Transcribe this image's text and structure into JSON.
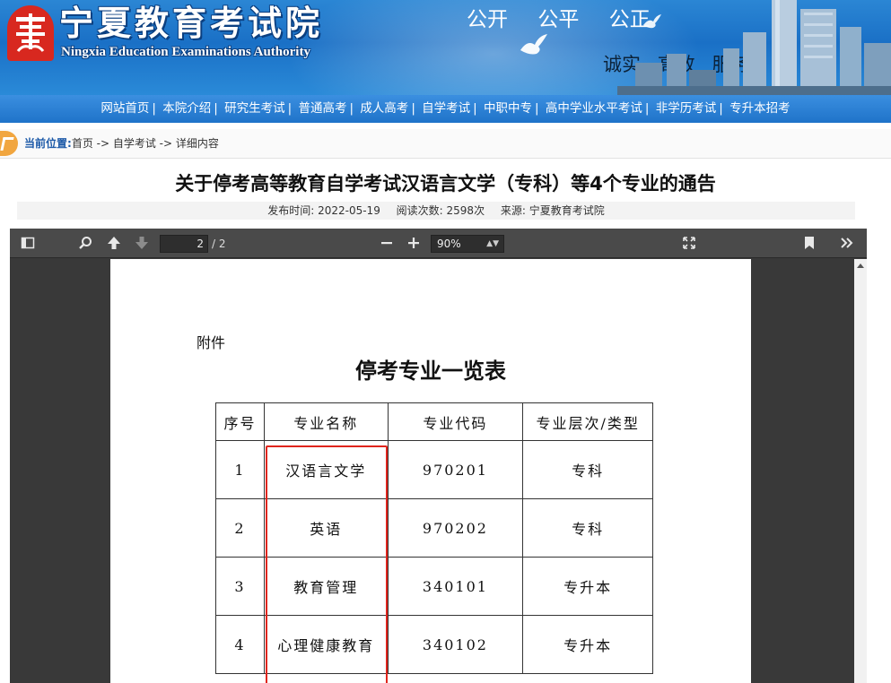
{
  "header": {
    "site_name_cn": "宁夏教育考试院",
    "site_name_en": "Ningxia Education Examinations Authority",
    "slogan_top": [
      "公开",
      "公平",
      "公正"
    ],
    "slogan_bottom": [
      "诚实",
      "高效",
      "服务"
    ]
  },
  "nav": {
    "items": [
      "网站首页",
      "本院介绍",
      "研究生考试",
      "普通高考",
      "成人高考",
      "自学考试",
      "中职中专",
      "高中学业水平考试",
      "非学历考试",
      "专升本招考"
    ]
  },
  "breadcrumb": {
    "label": "当前位置:",
    "path": "首页 -> 自学考试 -> 详细内容"
  },
  "article": {
    "title": "关于停考高等教育自学考试汉语言文学（专科）等4个专业的通告",
    "publish_time": "发布时间:   2022-05-19",
    "views": "阅读次数: 2598次",
    "source": "来源: 宁夏教育考试院"
  },
  "pdf_toolbar": {
    "page_number": "2",
    "page_count": "/ 2",
    "zoom": "90%"
  },
  "document": {
    "attachment_label": "附件",
    "title": "停考专业一览表",
    "table": {
      "headers": [
        "序号",
        "专业名称",
        "专业代码",
        "专业层次/类型"
      ],
      "rows": [
        [
          "1",
          "汉语言文学",
          "970201",
          "专科"
        ],
        [
          "2",
          "英语",
          "970202",
          "专科"
        ],
        [
          "3",
          "教育管理",
          "340101",
          "专升本"
        ],
        [
          "4",
          "心理健康教育",
          "340102",
          "专升本"
        ]
      ]
    }
  },
  "colors": {
    "banner_blue": "#1a70c6",
    "highlight_red": "#e0251c",
    "breadcrumb_accent": "#f1a640",
    "viewer_dark": "#393939"
  }
}
